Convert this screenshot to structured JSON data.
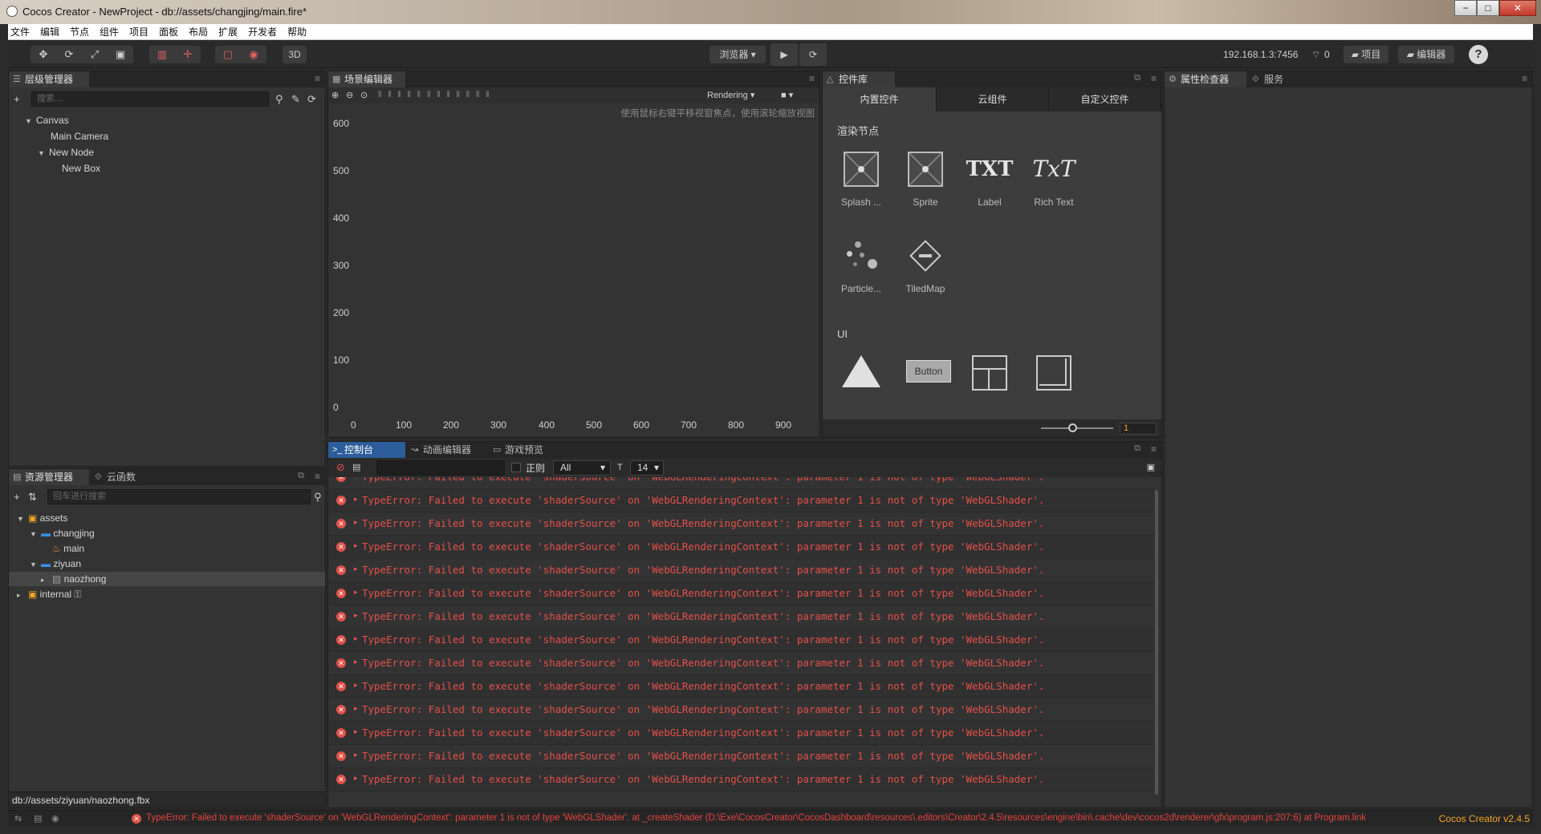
{
  "window": {
    "title": "Cocos Creator - NewProject - db://assets/changjing/main.fire*",
    "buttons": [
      "−",
      "□",
      "✕"
    ]
  },
  "menu": [
    "文件",
    "编辑",
    "节点",
    "组件",
    "项目",
    "面板",
    "布局",
    "扩展",
    "开发者",
    "帮助"
  ],
  "toolbar": {
    "mode_3d": "3D",
    "preview_select": "浏览器 ▾",
    "play_icon": "play-icon",
    "refresh_icon": "refresh-icon",
    "ip": "192.168.1.3:7456",
    "connections": "0",
    "project_button": "项目",
    "editor_button": "编辑器",
    "help": "?"
  },
  "hierarchy": {
    "tab": "层级管理器",
    "search_placeholder": "搜索...",
    "items": [
      {
        "label": "Canvas",
        "depth": 0,
        "expanded": true
      },
      {
        "label": "Main Camera",
        "depth": 1,
        "expanded": null
      },
      {
        "label": "New Node",
        "depth": 1,
        "expanded": true
      },
      {
        "label": "New Box",
        "depth": 2,
        "expanded": null
      }
    ]
  },
  "scene": {
    "tab": "场景编辑器",
    "rendering_select": "Rendering",
    "hint": "使用鼠标右键平移视窗焦点，使用滚轮缩放视图",
    "y_ticks": [
      "600",
      "500",
      "400",
      "300",
      "200",
      "100",
      "0"
    ],
    "x_ticks": [
      "0",
      "100",
      "200",
      "300",
      "400",
      "500",
      "600",
      "700",
      "800",
      "900"
    ]
  },
  "widgets": {
    "tab": "控件库",
    "tabs": [
      "内置控件",
      "云组件",
      "自定义控件"
    ],
    "section_render": "渲染节点",
    "render_items": [
      "Splash ...",
      "Sprite",
      "Label",
      "Rich Text",
      "Particle...",
      "TiledMap"
    ],
    "section_ui": "UI",
    "ui_button_text": "Button",
    "label_icon_text": "TXT",
    "richtext_icon_text": "TxT",
    "zoom_value": "1"
  },
  "inspector": {
    "tabs": [
      "属性检查器",
      "服务"
    ]
  },
  "assets": {
    "tabs": [
      "资源管理器",
      "云函数"
    ],
    "search_placeholder": "回车进行搜索",
    "items": [
      {
        "label": "assets",
        "depth": 0,
        "type": "root",
        "expanded": true
      },
      {
        "label": "changjing",
        "depth": 1,
        "type": "folder",
        "expanded": true
      },
      {
        "label": "main",
        "depth": 2,
        "type": "fire"
      },
      {
        "label": "ziyuan",
        "depth": 1,
        "type": "folder",
        "expanded": true
      },
      {
        "label": "naozhong",
        "depth": 2,
        "type": "fbx",
        "selected": true
      },
      {
        "label": "internal",
        "depth": 0,
        "type": "root-locked",
        "expanded": false
      }
    ],
    "selected_path": "db://assets/ziyuan/naozhong.fbx"
  },
  "console": {
    "tabs": [
      "控制台",
      "动画编辑器",
      "游戏预览"
    ],
    "regex_label": "正则",
    "level_select": "All",
    "font_size": "14",
    "error_line": "TypeError: Failed to execute 'shaderSource' on 'WebGLRenderingContext': parameter 1 is not of type 'WebGLShader'.",
    "rows": 14
  },
  "statusbar": {
    "message": "TypeError: Failed to execute 'shaderSource' on 'WebGLRenderingContext': parameter 1 is not of type 'WebGLShader'. at _createShader (D:\\Exe\\CocosCreator\\CocosDashboard\\resources\\.editors\\Creator\\2.4.5\\resources\\engine\\bin\\.cache\\dev\\cocos2d\\renderer\\gfx\\program.js:207:6) at Program.link",
    "version": "Cocos Creator v2.4.5"
  },
  "colors": {
    "accent_blue": "#2d5d9a",
    "error_red": "#e4504a",
    "version_orange": "#f5a623"
  }
}
